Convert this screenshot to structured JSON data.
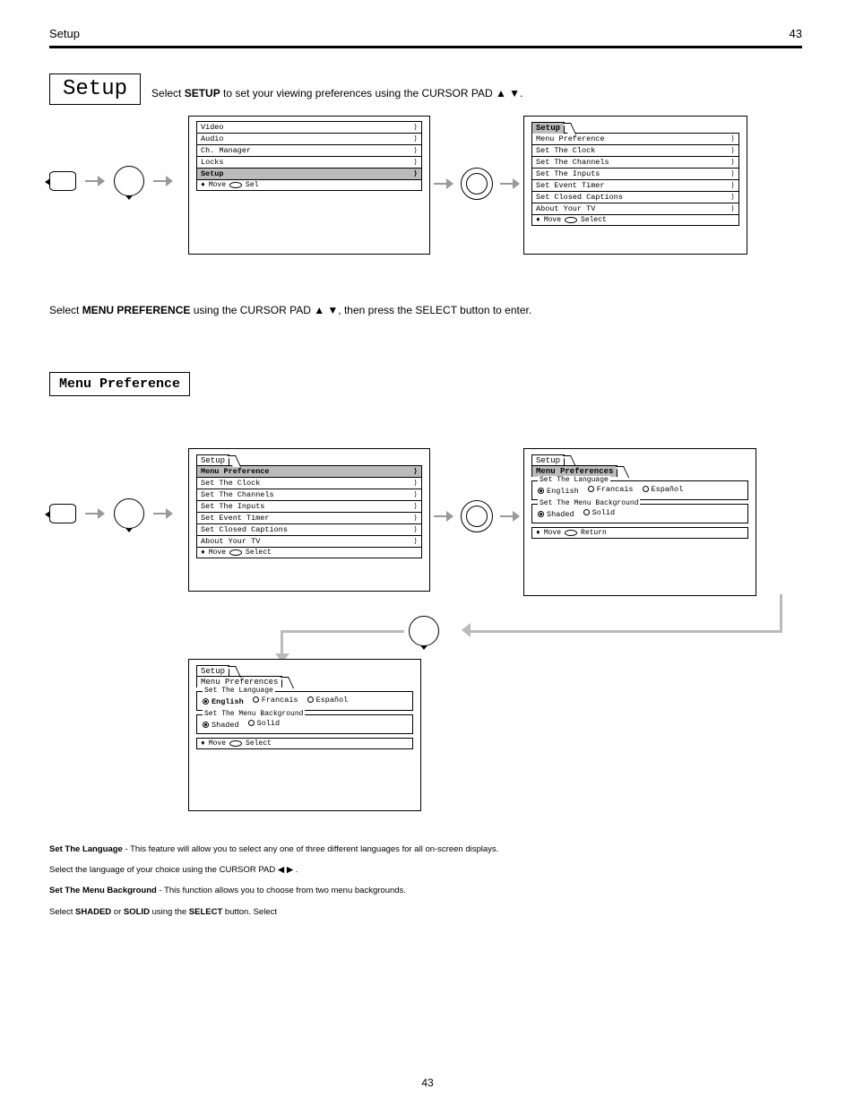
{
  "header": {
    "left_title": "Setup",
    "right_num": "43"
  },
  "section1": {
    "title_box": "Setup",
    "step_pre": "Select ",
    "step_mid": " to set your viewing preferences using the CURSOR PAD ",
    "arrows": "▲ ▼",
    "step_post": ".",
    "screen1": {
      "items": [
        "Video",
        "Audio",
        "Ch. Manager",
        "Locks",
        "Setup"
      ],
      "selected": "Setup",
      "footer_move": "Move",
      "footer_sel": "Sel"
    },
    "screen2": {
      "tab": "Setup",
      "items": [
        "Menu Preference",
        "Set The Clock",
        "Set The Channels",
        "Set The Inputs",
        "Set Event Timer",
        "Set Closed Captions",
        "About Your TV"
      ],
      "footer_move": "Move",
      "footer_sel": "Select"
    }
  },
  "section2": {
    "title_box": "Menu Preference",
    "step_pre": "Select ",
    "bold": "MENU PREFERENCE",
    "step_mid": " using the CURSOR PAD ",
    "arrows": "▲ ▼",
    "step_post": ", then press the SELECT button to enter.",
    "screen3": {
      "tab": "Setup",
      "items": [
        "Menu Preference",
        "Set The Clock",
        "Set The Channels",
        "Set The Inputs",
        "Set Event Timer",
        "Set Closed Captions",
        "About Your TV"
      ],
      "selected": "Menu Preference",
      "footer_move": "Move",
      "footer_sel": "Select"
    },
    "screen4": {
      "tab1": "Setup",
      "tab2": "Menu Preferences",
      "field1_legend": "Set The Language",
      "lang_opts": [
        "English",
        "Francais",
        "Español"
      ],
      "field2_legend": "Set The Menu Background",
      "bg_opts": [
        "Shaded",
        "Solid"
      ],
      "footer_move": "Move",
      "footer_return": "Return"
    },
    "screen5": {
      "tab1": "Setup",
      "tab2": "Menu Preferences",
      "field1_legend": "Set The Language",
      "lang_opts": [
        "English",
        "Francais",
        "Español"
      ],
      "lang_selected": "English",
      "field2_legend": "Set The Menu Background",
      "bg_opts": [
        "Shaded",
        "Solid"
      ],
      "footer_move": "Move",
      "footer_sel": "Select"
    }
  },
  "notes": {
    "n1_head": "Set The Language",
    "n1_body": " - This feature will allow you to select any one of three different languages for all on-screen displays.",
    "n2_pre": "Select the language of your choice using the CURSOR PAD ",
    "n2_arrows": "◀ ▶",
    "n2_post": " .",
    "n3_head": "Set The Menu Background",
    "n3_body": " - This function allows you to choose from two menu backgrounds.",
    "n4_pre": "Select ",
    "n4_bold": "SHADED",
    "n4_mid": " or ",
    "n4_bold2": "SOLID",
    "n4_mid2": " using the ",
    "n4_bold3": "SELECT",
    "n4_mid3": " button. Select "
  },
  "page_num": "43"
}
